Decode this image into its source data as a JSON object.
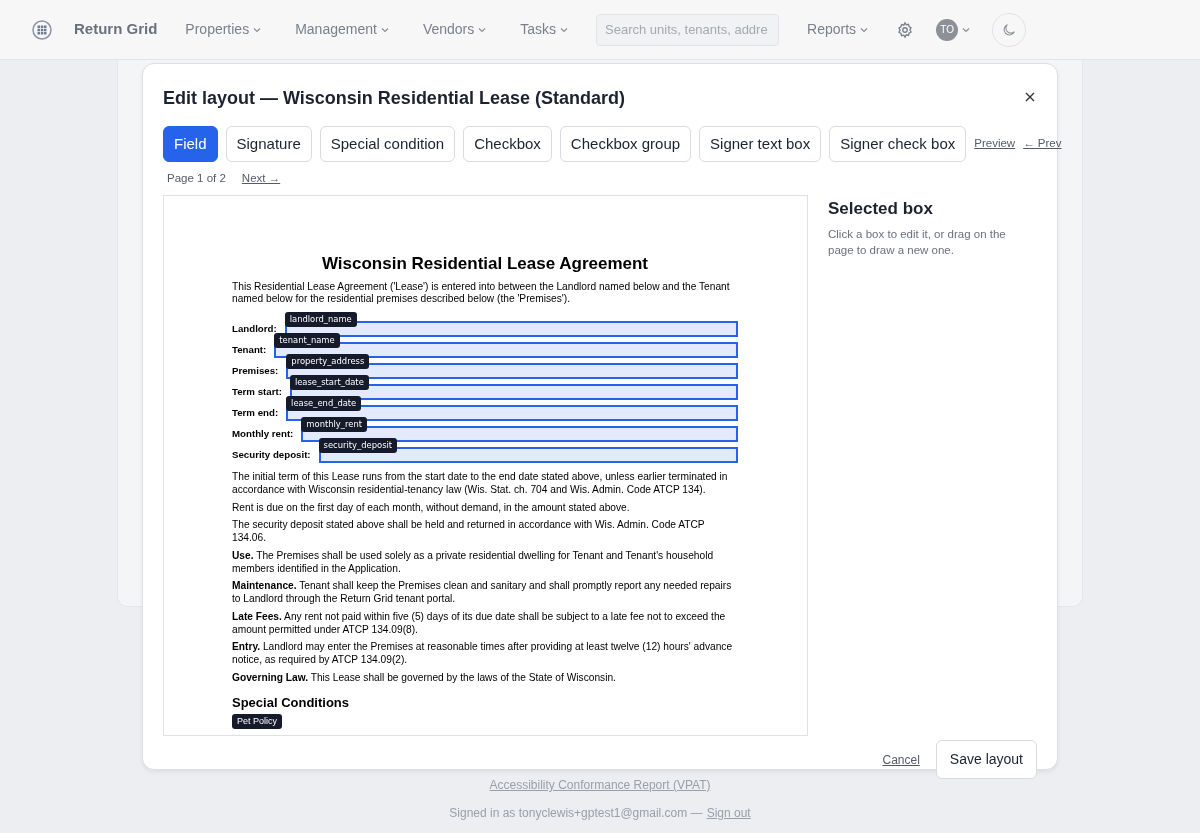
{
  "navbar": {
    "brand": "Return Grid",
    "menus": [
      {
        "label": "Properties"
      },
      {
        "label": "Management"
      },
      {
        "label": "Vendors"
      },
      {
        "label": "Tasks"
      }
    ],
    "search": {
      "placeholder": "Search units, tenants, addre"
    },
    "right_menus": [
      {
        "label": "Reports"
      }
    ],
    "avatar": "TO"
  },
  "modal": {
    "title": "Edit layout — Wisconsin Residential Lease (Standard)",
    "tools": [
      {
        "label": "Field",
        "selected": true
      },
      {
        "label": "Signature",
        "selected": false
      },
      {
        "label": "Special condition",
        "selected": false
      },
      {
        "label": "Checkbox",
        "selected": false
      },
      {
        "label": "Checkbox group",
        "selected": false
      },
      {
        "label": "Signer text box",
        "selected": false
      },
      {
        "label": "Signer check box",
        "selected": false
      }
    ],
    "links": [
      "Preview",
      "← Prev"
    ],
    "pager": {
      "text": "Page 1 of 2",
      "next": "Next →"
    },
    "document": {
      "title": "Wisconsin Residential Lease Agreement",
      "intro": "This Residential Lease Agreement ('Lease') is entered into between the Landlord named below and the Tenant named below for the residential premises described below (the 'Premises').",
      "fields": [
        {
          "label": "Landlord:",
          "tag": "landlord_name"
        },
        {
          "label": "Tenant:",
          "tag": "tenant_name"
        },
        {
          "label": "Premises:",
          "tag": "property_address"
        },
        {
          "label": "Term start:",
          "tag": "lease_start_date"
        },
        {
          "label": "Term end:",
          "tag": "lease_end_date"
        },
        {
          "label": "Monthly rent:",
          "tag": "monthly_rent"
        },
        {
          "label": "Security deposit:",
          "tag": "security_deposit"
        }
      ],
      "paragraphs": [
        "The initial term of this Lease runs from the start date to the end date stated above, unless earlier terminated in accordance with Wisconsin residential-tenancy law (Wis. Stat. ch. 704 and Wis. Admin. Code ATCP 134).",
        "Rent is due on the first day of each month, without demand, in the amount stated above.",
        "The security deposit stated above shall be held and returned in accordance with Wis. Admin. Code ATCP 134.06.",
        "**Use.** The Premises shall be used solely as a private residential dwelling for Tenant and Tenant's household members identified in the Application.",
        "**Maintenance.** Tenant shall keep the Premises clean and sanitary and shall promptly report any needed repairs to Landlord through the Return Grid tenant portal.",
        "**Late Fees.** Any rent not paid within five (5) days of its due date shall be subject to a late fee not to exceed the amount permitted under ATCP 134.09(8).",
        "**Entry.** Landlord may enter the Premises at reasonable times after providing at least twelve (12) hours' advance notice, as required by ATCP 134.09(2).",
        "**Governing Law.** This Lease shall be governed by the laws of the State of Wisconsin."
      ],
      "section_heading": "Special Conditions",
      "condition_tags": [
        "Pet Policy"
      ]
    },
    "side": {
      "heading": "Selected box",
      "hint": "Click a box to edit it, or drag on the page to draw a new one."
    },
    "cancel": "Cancel",
    "save": "Save layout"
  },
  "footer": {
    "link": "Accessibility Conformance Report (VPAT)",
    "signed_in": "Signed in as tonyclewis+gptest1@gmail.com —",
    "sign_out": "Sign out"
  }
}
